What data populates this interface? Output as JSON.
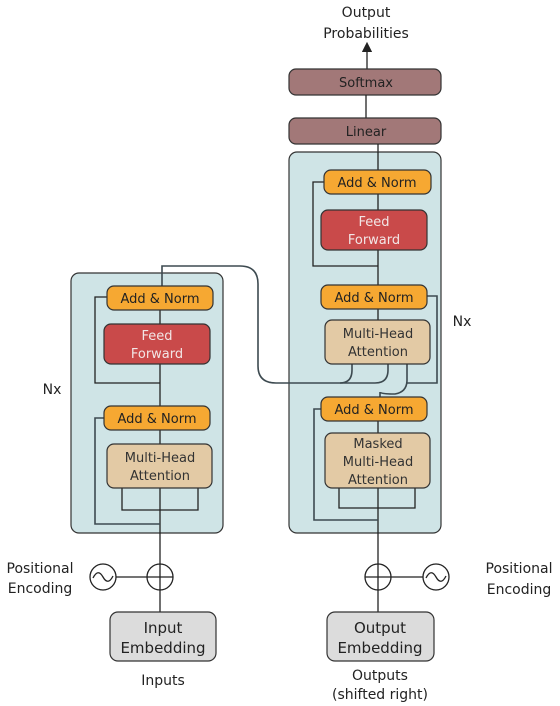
{
  "output": {
    "line1": "Output",
    "line2": "Probabilities"
  },
  "softmax": "Softmax",
  "linear": "Linear",
  "encoder": {
    "repeat": "Nx",
    "add_norm_top": "Add & Norm",
    "feed_forward": [
      "Feed",
      "Forward"
    ],
    "add_norm_bottom": "Add & Norm",
    "attention": [
      "Multi-Head",
      "Attention"
    ]
  },
  "decoder": {
    "repeat": "Nx",
    "add_norm_top": "Add & Norm",
    "feed_forward": [
      "Feed",
      "Forward"
    ],
    "add_norm_mid": "Add & Norm",
    "attention": [
      "Multi-Head",
      "Attention"
    ],
    "add_norm_bottom": "Add & Norm",
    "masked_attention": [
      "Masked",
      "Multi-Head",
      "Attention"
    ]
  },
  "left_positional": [
    "Positional",
    "Encoding"
  ],
  "right_positional": [
    "Positional",
    "Encoding"
  ],
  "input_embedding": [
    "Input",
    "Embedding"
  ],
  "output_embedding": [
    "Output",
    "Embedding"
  ],
  "inputs_label": "Inputs",
  "outputs_label": [
    "Outputs",
    "(shifted right)"
  ],
  "colors": {
    "block": "#cfe4e6",
    "add_norm": "#f6a832",
    "feed_forward": "#c94a4a",
    "attention": "#e3caa5",
    "linear_softmax": "#a27878",
    "embedding": "#dcdcdc"
  }
}
